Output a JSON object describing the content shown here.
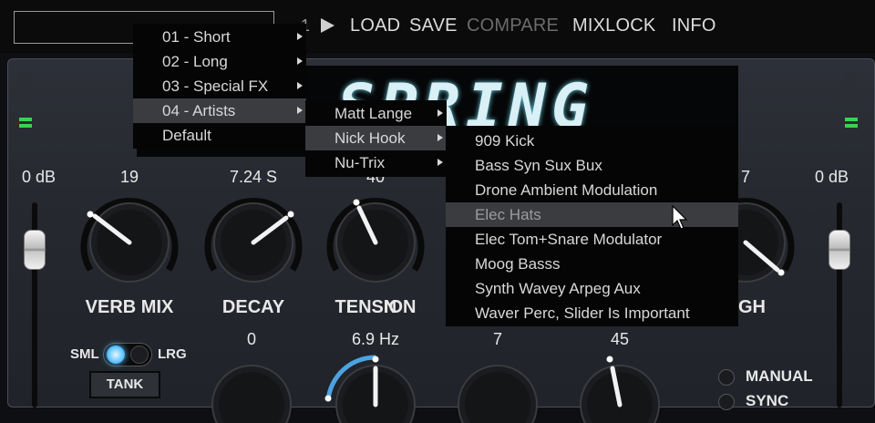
{
  "topbar": {
    "preset_number": "1",
    "play_icon": "play-icon",
    "load": "LOAD",
    "save": "SAVE",
    "compare": "COMPARE",
    "mixlock": "MIXLOCK",
    "info": "INFO"
  },
  "display": {
    "text": "SPRING"
  },
  "levels": {
    "left": "0 dB",
    "right": "0 dB"
  },
  "knobs": {
    "verb_mix": {
      "value": "19",
      "label": "VERB MIX"
    },
    "decay": {
      "value": "7.24 S",
      "label": "DECAY"
    },
    "tension": {
      "value": "40",
      "label": "TENSION"
    },
    "high": {
      "value": "7",
      "label": "HIGH",
      "label_visible": "GH"
    },
    "tension_letter": "N",
    "row2": {
      "k1": "0",
      "k2": "6.9 Hz",
      "k3": "7",
      "k4": "45"
    }
  },
  "switches": {
    "sml": "SML",
    "lrg": "LRG",
    "tank": "TANK",
    "manual": "MANUAL",
    "sync": "SYNC"
  },
  "menu_main": {
    "items": [
      {
        "label": "01 - Short"
      },
      {
        "label": "02 - Long"
      },
      {
        "label": "03 - Special FX"
      },
      {
        "label": "04 - Artists"
      },
      {
        "label": "Default"
      }
    ]
  },
  "menu_artists": {
    "items": [
      {
        "label": "Matt Lange"
      },
      {
        "label": "Nick Hook"
      },
      {
        "label": "Nu-Trix"
      }
    ]
  },
  "menu_presets": {
    "items": [
      {
        "label": "909 Kick"
      },
      {
        "label": "Bass Syn Sux Bux"
      },
      {
        "label": "Drone Ambient Modulation"
      },
      {
        "label": "Elec Hats"
      },
      {
        "label": "Elec Tom+Snare Modulator"
      },
      {
        "label": "Moog Basss"
      },
      {
        "label": "Synth Wavey Arpeg Aux"
      },
      {
        "label": "Waver Perc, Slider Is Important"
      }
    ]
  }
}
